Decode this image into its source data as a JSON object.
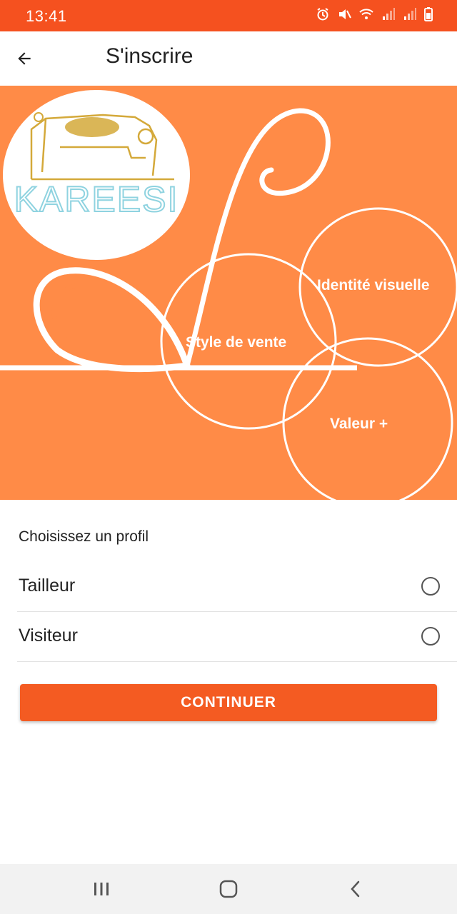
{
  "status_bar": {
    "time": "13:41",
    "icons": [
      "alarm-icon",
      "mute-icon",
      "wifi-icon",
      "signal-icon",
      "signal-icon",
      "battery-icon"
    ]
  },
  "app_bar": {
    "title": "S'inscrire",
    "back_icon": "arrow-left-icon"
  },
  "banner": {
    "logo_text": "KAREESI",
    "bubbles": [
      "Identité visuelle",
      "Style de vente",
      "Valeur +"
    ]
  },
  "profile": {
    "section_label": "Choisissez un profil",
    "options": [
      {
        "label": "Tailleur",
        "selected": false
      },
      {
        "label": "Visiteur",
        "selected": false
      }
    ]
  },
  "continue_label": "CONTINUER",
  "nav_bar": {
    "buttons": [
      "recent-apps-icon",
      "home-icon",
      "back-icon"
    ]
  },
  "colors": {
    "status_bar": "#f5511f",
    "banner": "#ff8b47",
    "button": "#f45b22",
    "logo_outline": "#8fd3e0",
    "logo_gold": "#d4a93a"
  }
}
